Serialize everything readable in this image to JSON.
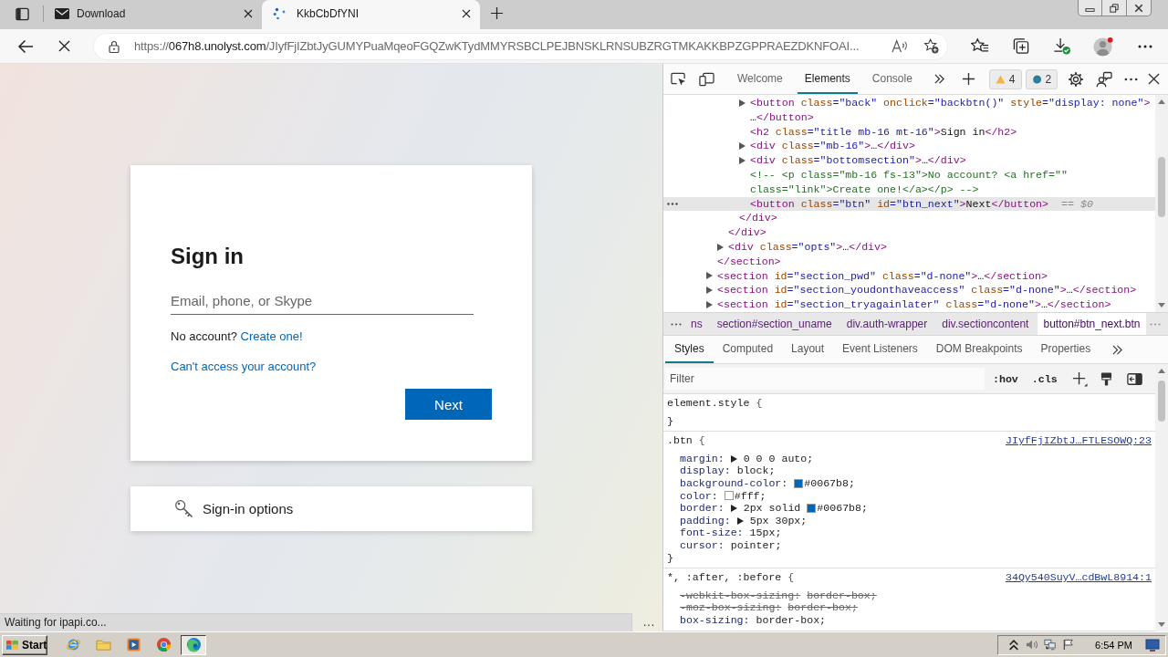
{
  "browser": {
    "tabs": [
      {
        "title": "Download",
        "kind": "mail",
        "selected": false
      },
      {
        "title": "KkbCbDfYNI",
        "kind": "loading",
        "selected": true
      }
    ],
    "address": {
      "scheme": "https://",
      "host": "067h8.unolyst.com",
      "path": "/JIyfFjIZbtJyGUMYPuaMqeoFGQZwKTydMMYRSBCLPEJBNSKLRNSUBZRGTMKAKKBPZGPPRAEZDKNFOAI..."
    }
  },
  "page": {
    "title": "Sign in",
    "email_field": {
      "placeholder": "Email, phone, or Skype"
    },
    "no_account": "No account?",
    "create_link": "Create one!",
    "cant_access_link": "Can't access your account?",
    "next_button": "Next",
    "signin_options": "Sign-in options",
    "footer_more": "...",
    "status": "Waiting for ipapi.co..."
  },
  "devtools": {
    "tabs": [
      {
        "label": "Welcome",
        "selected": false
      },
      {
        "label": "Elements",
        "selected": true
      },
      {
        "label": "Console",
        "selected": false
      }
    ],
    "issues": [
      {
        "kind": "warning",
        "count": "4"
      },
      {
        "kind": "info",
        "count": "2"
      }
    ],
    "dom_tree": [
      {
        "kind": "continued",
        "selected": false,
        "close": "</section>",
        "children": [
          {
            "kind": "continued",
            "selected": false,
            "close": "</div>",
            "children": [
              {
                "kind": "continued",
                "selected": false,
                "close": "</div>",
                "children": [
                  {
                    "kind": "element",
                    "selected": false,
                    "expanded": false,
                    "tokens": [
                      {
                        "kind": "tag",
                        "s": "<button"
                      },
                      {
                        "kind": "attr",
                        "s": " class"
                      },
                      {
                        "kind": "value",
                        "s": "=\"back\""
                      },
                      {
                        "kind": "attr",
                        "s": " onclick"
                      },
                      {
                        "kind": "value",
                        "s": "=\"backbtn()\""
                      },
                      {
                        "kind": "attr",
                        "s": " style"
                      },
                      {
                        "kind": "value",
                        "s": "=\"display: none\""
                      },
                      {
                        "kind": "tag",
                        "s": ">"
                      }
                    ],
                    "ellipsis": "…",
                    "close": "</button>"
                  },
                  {
                    "kind": "leaf",
                    "selected": false,
                    "tokens": [
                      {
                        "kind": "tag",
                        "s": "<h2"
                      },
                      {
                        "kind": "attr",
                        "s": " class"
                      },
                      {
                        "kind": "value",
                        "s": "=\"title mb-16 mt-16\""
                      },
                      {
                        "kind": "tag",
                        "s": ">"
                      },
                      {
                        "kind": "text",
                        "s": "Sign in"
                      },
                      {
                        "kind": "tag",
                        "s": "</h2>"
                      }
                    ]
                  },
                  {
                    "kind": "element",
                    "selected": false,
                    "expanded": false,
                    "tokens": [
                      {
                        "kind": "tag",
                        "s": "<div"
                      },
                      {
                        "kind": "attr",
                        "s": " class"
                      },
                      {
                        "kind": "value",
                        "s": "=\"mb-16\""
                      },
                      {
                        "kind": "tag",
                        "s": ">"
                      }
                    ],
                    "ellipsis": "…",
                    "close": "</div>"
                  },
                  {
                    "kind": "element",
                    "selected": false,
                    "expanded": false,
                    "tokens": [
                      {
                        "kind": "tag",
                        "s": "<div"
                      },
                      {
                        "kind": "attr",
                        "s": " class"
                      },
                      {
                        "kind": "value",
                        "s": "=\"bottomsection\""
                      },
                      {
                        "kind": "tag",
                        "s": ">"
                      }
                    ],
                    "ellipsis": "…",
                    "close": "</div>"
                  },
                  {
                    "kind": "comment",
                    "selected": false,
                    "text": "<!-- <p class=\"mb-16 fs-13\">No account? <a href=\"\" class=\"link\">Create one!</a></p> -->"
                  },
                  {
                    "kind": "leaf",
                    "selected": true,
                    "tokens": [
                      {
                        "kind": "tag",
                        "s": "<button"
                      },
                      {
                        "kind": "attr",
                        "s": " class"
                      },
                      {
                        "kind": "value",
                        "s": "=\"btn\""
                      },
                      {
                        "kind": "attr",
                        "s": " id"
                      },
                      {
                        "kind": "value",
                        "s": "=\"btn_next\""
                      },
                      {
                        "kind": "tag",
                        "s": ">"
                      },
                      {
                        "kind": "text",
                        "s": "Next"
                      },
                      {
                        "kind": "tag",
                        "s": "</button>"
                      }
                    ]
                  }
                ]
              }
            ]
          },
          {
            "kind": "element",
            "selected": false,
            "expanded": false,
            "tokens": [
              {
                "kind": "tag",
                "s": "<div"
              },
              {
                "kind": "attr",
                "s": " class"
              },
              {
                "kind": "value",
                "s": "=\"opts\""
              },
              {
                "kind": "tag",
                "s": ">"
              }
            ],
            "ellipsis": "…",
            "close": "</div>"
          }
        ]
      },
      {
        "kind": "element",
        "selected": false,
        "expanded": false,
        "tokens": [
          {
            "kind": "tag",
            "s": "<section"
          },
          {
            "kind": "attr",
            "s": " id"
          },
          {
            "kind": "value",
            "s": "=\"section_pwd\""
          },
          {
            "kind": "attr",
            "s": " class"
          },
          {
            "kind": "value",
            "s": "=\"d-none\""
          },
          {
            "kind": "tag",
            "s": ">"
          }
        ],
        "ellipsis": "…",
        "close": "</section>"
      },
      {
        "kind": "element",
        "selected": false,
        "expanded": false,
        "tokens": [
          {
            "kind": "tag",
            "s": "<section"
          },
          {
            "kind": "attr",
            "s": " id"
          },
          {
            "kind": "value",
            "s": "=\"section_youdonthaveaccess\""
          },
          {
            "kind": "attr",
            "s": " class"
          },
          {
            "kind": "value",
            "s": "=\"d-none\""
          },
          {
            "kind": "tag",
            "s": ">"
          }
        ],
        "ellipsis": "…",
        "close": "</section>"
      },
      {
        "kind": "element",
        "selected": false,
        "expanded": false,
        "tokens": [
          {
            "kind": "tag",
            "s": "<section"
          },
          {
            "kind": "attr",
            "s": " id"
          },
          {
            "kind": "value",
            "s": "=\"section_tryagainlater\""
          },
          {
            "kind": "attr",
            "s": " class"
          },
          {
            "kind": "value",
            "s": "=\"d-none\""
          },
          {
            "kind": "tag",
            "s": ">"
          }
        ],
        "ellipsis": "…",
        "close": "</section>"
      }
    ],
    "selected_marker": "== $0",
    "breadcrumbs": [
      {
        "label": "ns",
        "selected": false
      },
      {
        "label": "section#section_uname",
        "selected": false
      },
      {
        "label": "div.auth-wrapper",
        "selected": false
      },
      {
        "label": "div.sectioncontent",
        "selected": false
      },
      {
        "label": "button#btn_next.btn",
        "selected": true
      }
    ],
    "style_tabs": [
      {
        "label": "Styles",
        "selected": true
      },
      {
        "label": "Computed",
        "selected": false
      },
      {
        "label": "Layout",
        "selected": false
      },
      {
        "label": "Event Listeners",
        "selected": false
      },
      {
        "label": "DOM Breakpoints",
        "selected": false
      },
      {
        "label": "Properties",
        "selected": false
      }
    ],
    "filter": {
      "placeholder": "Filter"
    },
    "hov_button": ":hov",
    "cls_button": ".cls",
    "rules": [
      {
        "selector": "element.style",
        "open": "{",
        "close": "}"
      },
      {
        "selector": ".btn",
        "open": "{",
        "close": "}",
        "source": "JIyfFjIZbtJ…FTLESOWQ:23",
        "properties": [
          {
            "name": "margin:",
            "kind": "shorthand",
            "overridden": false,
            "parts": [
              {
                "text": "0 0 0 auto;"
              }
            ]
          },
          {
            "name": "display:",
            "kind": "longhand",
            "overridden": false,
            "parts": [
              {
                "text": "block;"
              }
            ]
          },
          {
            "name": "background-color:",
            "kind": "longhand",
            "overridden": false,
            "parts": [
              {
                "text": "#0067b8;",
                "color": "#0067b8"
              }
            ]
          },
          {
            "name": "color:",
            "kind": "longhand",
            "overridden": false,
            "parts": [
              {
                "text": "#fff;",
                "color": "#ffffff"
              }
            ]
          },
          {
            "name": "border:",
            "kind": "shorthand",
            "overridden": false,
            "parts": [
              {
                "text": "2px solid"
              },
              {
                "text": "#0067b8;",
                "color": "#0067b8"
              }
            ]
          },
          {
            "name": "padding:",
            "kind": "shorthand",
            "overridden": false,
            "parts": [
              {
                "text": "5px 30px;"
              }
            ]
          },
          {
            "name": "font-size:",
            "kind": "longhand",
            "overridden": false,
            "parts": [
              {
                "text": "15px;"
              }
            ]
          },
          {
            "name": "cursor:",
            "kind": "longhand",
            "overridden": false,
            "parts": [
              {
                "text": "pointer;"
              }
            ]
          }
        ]
      },
      {
        "selector": "*, :after, :before",
        "open": "{",
        "source": "34Qy540SuyV…cdBwL8914:1",
        "properties": [
          {
            "name": "-webkit-box-sizing:",
            "kind": "longhand",
            "overridden": true,
            "parts": [
              {
                "text": "border-box;"
              }
            ]
          },
          {
            "name": "-moz-box-sizing:",
            "kind": "longhand",
            "overridden": true,
            "parts": [
              {
                "text": "border-box;"
              }
            ]
          },
          {
            "name": "box-sizing:",
            "kind": "longhand",
            "overridden": false,
            "parts": [
              {
                "text": "border-box;"
              }
            ]
          }
        ]
      }
    ]
  },
  "taskbar": {
    "start": "Start",
    "apps": [
      {
        "kind": "globe",
        "selected": false
      },
      {
        "kind": "folder",
        "selected": false
      },
      {
        "kind": "player",
        "selected": false
      },
      {
        "kind": "ball",
        "selected": false
      },
      {
        "kind": "swirl",
        "selected": true
      }
    ],
    "clock": "6:54 PM"
  }
}
